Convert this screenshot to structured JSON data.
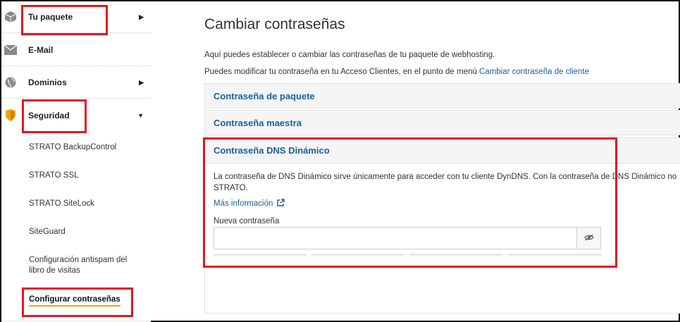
{
  "sidebar": {
    "items": [
      {
        "label": "Tu paquete",
        "icon": "package-icon"
      },
      {
        "label": "E-Mail",
        "icon": "envelope-icon"
      },
      {
        "label": "Dominios",
        "icon": "globe-icon"
      },
      {
        "label": "Seguridad",
        "icon": "shield-icon"
      }
    ],
    "sub_items": [
      "STRATO BackupControl",
      "STRATO SSL",
      "STRATO SiteLock",
      "SiteGuard",
      "Configuración antispam del libro de visitas",
      "Configurar contraseñas"
    ]
  },
  "main": {
    "title": "Cambiar contraseñas",
    "intro_1": "Aquí puedes establecer o cambiar las contraseñas de tu paquete de webhosting.",
    "intro_2": "Puedes modificar tu contraseña en tu Acceso Clientes, en el punto de menú",
    "intro_2_link": "Cambiar contraseña de cliente",
    "panels": [
      "Contraseña de paquete",
      "Contraseña maestra",
      "Contraseña DNS Dinámico"
    ],
    "dyndns": {
      "description_1": "La contraseña de DNS Dinámico sirve únicamente para acceder con tu cliente DynDNS. Con la contraseña de DNS Dinámico no",
      "description_2": "STRATO.",
      "more_link": "Más información",
      "field_label": "Nueva contraseña",
      "field_value": ""
    }
  },
  "colors": {
    "link": "#1a5e9e",
    "highlight": "#e8141c",
    "active_underline": "#f0a500",
    "shield": "#f0a500"
  }
}
